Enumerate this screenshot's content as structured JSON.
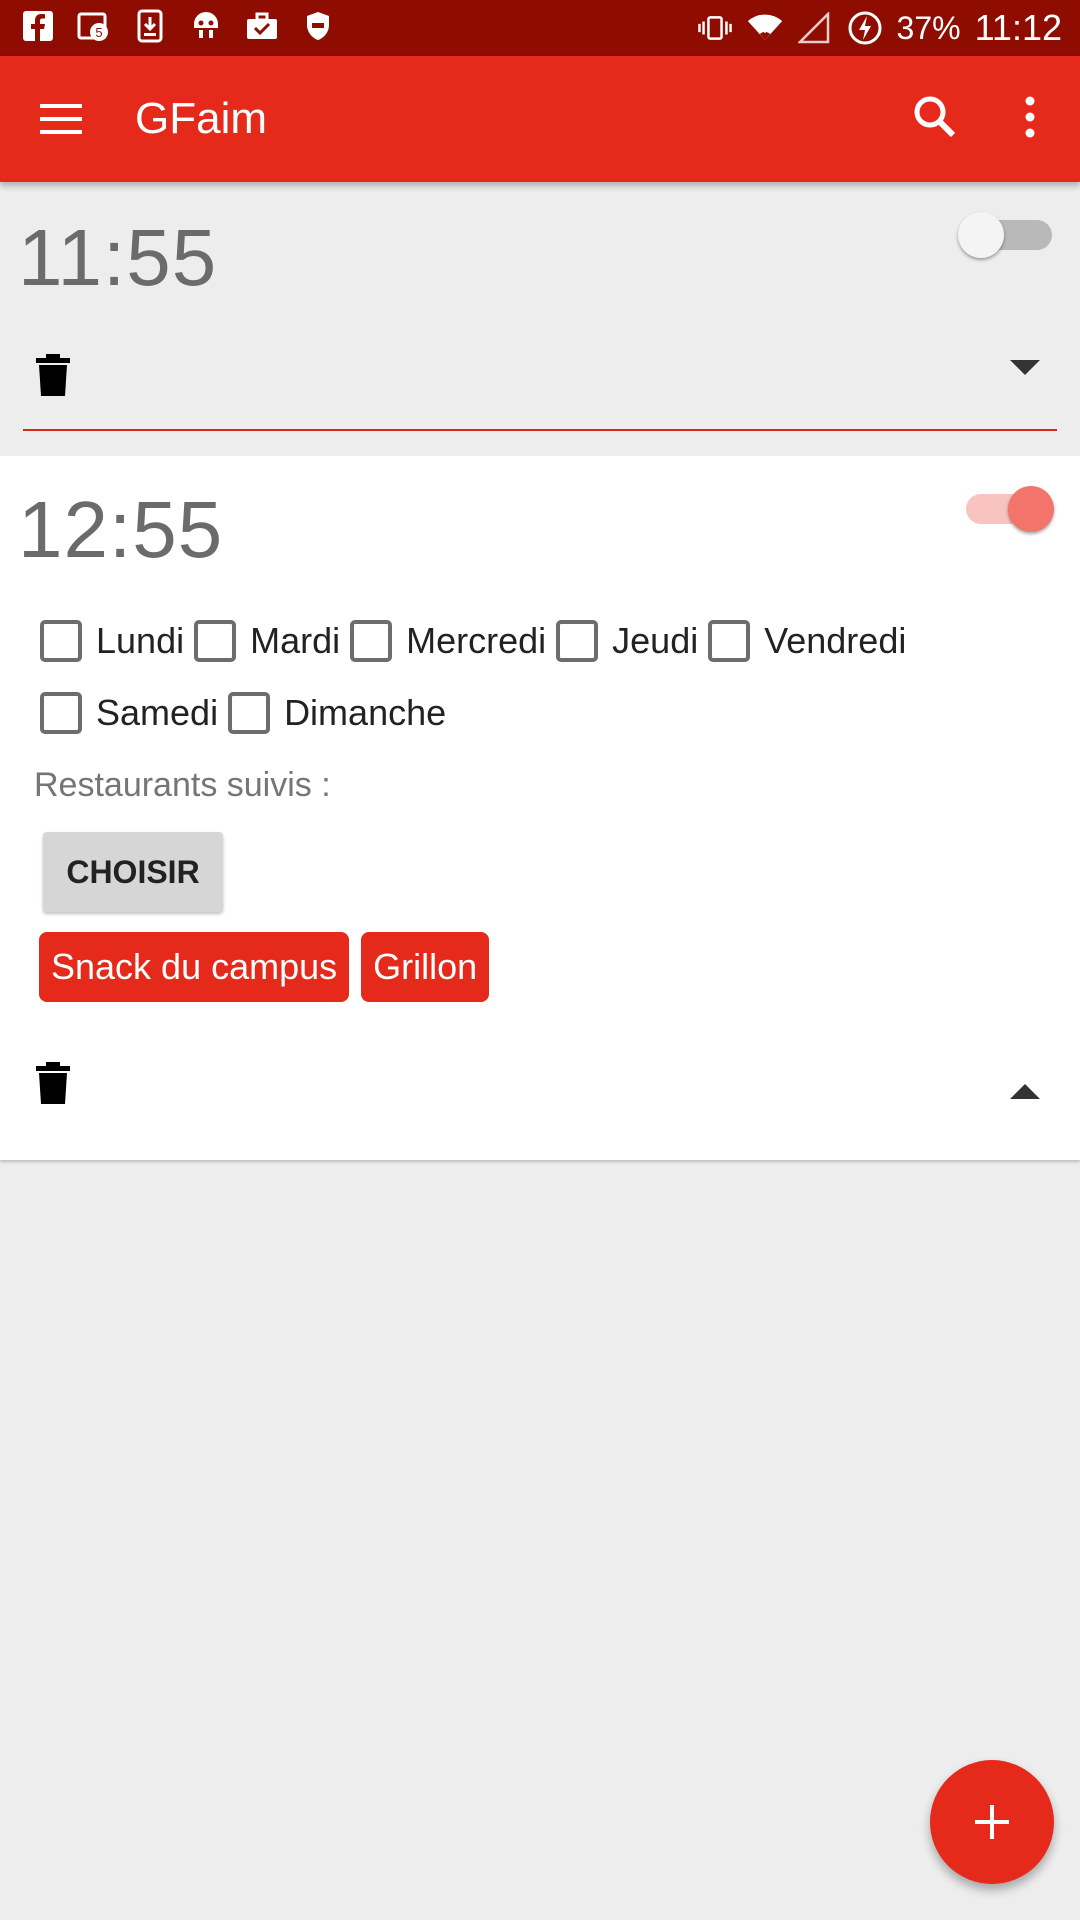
{
  "status_bar": {
    "left_icons": [
      "facebook-icon",
      "calendar-icon",
      "download-icon",
      "android-head-icon",
      "briefcase-check-icon",
      "shield-icon"
    ],
    "right_icons": [
      "vibrate-icon",
      "wifi-icon",
      "cell-signal-icon",
      "battery-charging-icon"
    ],
    "battery": "37%",
    "time": "11:12"
  },
  "app_bar": {
    "title": "GFaim",
    "menu_icon": "menu-icon",
    "search_icon": "search-icon",
    "more_icon": "more-vert-icon"
  },
  "alarms": [
    {
      "time": "11:55",
      "enabled": false,
      "expanded": false
    },
    {
      "time": "12:55",
      "enabled": true,
      "expanded": true,
      "days": [
        {
          "label": "Lundi",
          "checked": false
        },
        {
          "label": "Mardi",
          "checked": false
        },
        {
          "label": "Mercredi",
          "checked": false
        },
        {
          "label": "Jeudi",
          "checked": false
        },
        {
          "label": "Vendredi",
          "checked": false
        },
        {
          "label": "Samedi",
          "checked": false
        },
        {
          "label": "Dimanche",
          "checked": false
        }
      ],
      "restaurants_label": "Restaurants suivis :",
      "choose_label": "CHOISIR",
      "restaurants": [
        "Snack du campus",
        "Grillon"
      ]
    }
  ],
  "fab": {
    "icon": "add-icon"
  },
  "colors": {
    "status_bar": "#8e0c00",
    "primary": "#e5291b",
    "background": "#ededed",
    "switch_on_thumb": "#f4736a",
    "switch_on_track": "#f9c4bf"
  }
}
